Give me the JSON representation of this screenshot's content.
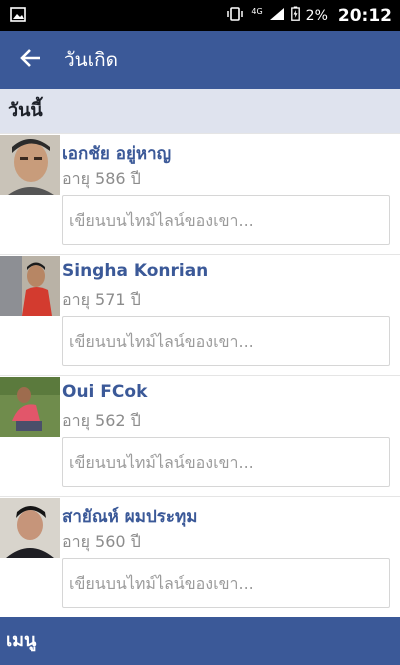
{
  "status_bar": {
    "network": "4G",
    "battery": "2%",
    "time": "20:12"
  },
  "app_bar": {
    "title": "วันเกิด",
    "back_icon": "arrow-left-icon"
  },
  "section": {
    "label": "วันนี้"
  },
  "people": [
    {
      "name": "เอกชัย อยู่หาญ",
      "age": "อายุ 586 ปี",
      "placeholder": "เขียนบนไทม์ไลน์ของเขา..."
    },
    {
      "name": "Singha Konrian",
      "age": "อายุ 571 ปี",
      "placeholder": "เขียนบนไทม์ไลน์ของเขา..."
    },
    {
      "name": "Oui FCok",
      "age": "อายุ 562 ปี",
      "placeholder": "เขียนบนไทม์ไลน์ของเขา..."
    },
    {
      "name": "สายัณห์ ผมประทุม",
      "age": "อายุ 560 ปี",
      "placeholder": "เขียนบนไทม์ไลน์ของเขา..."
    }
  ],
  "menu": {
    "label": "เมนู"
  },
  "colors": {
    "brand": "#3b5998",
    "section_bg": "#dfe3ee"
  }
}
